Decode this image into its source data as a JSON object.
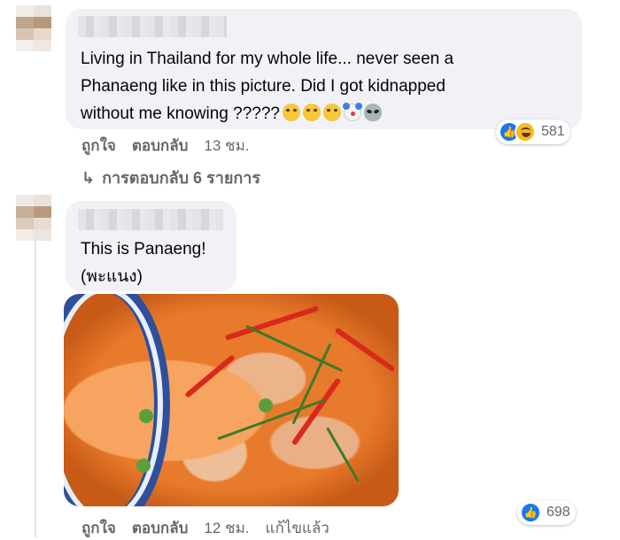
{
  "comments": [
    {
      "text": "Living in Thailand for my whole life... never seen a\nPhanaeng like in this picture. Did I got kidnapped\nwithout me knowing ?????",
      "emojis": [
        "crying-face",
        "crying-face",
        "crying-face",
        "clown-face",
        "alien-face"
      ],
      "reactions": {
        "icons": [
          "like-reaction-icon",
          "haha-reaction-icon"
        ],
        "count": "581"
      },
      "actions": {
        "like": "ถูกใจ",
        "reply": "ตอบกลับ",
        "time": "13 ชม."
      },
      "replies_link": "การตอบกลับ 6 รายการ"
    },
    {
      "text": "This is Panaeng!\n(พะแนง)",
      "reactions": {
        "icons": [
          "like-reaction-icon"
        ],
        "count": "698"
      },
      "actions": {
        "like": "ถูกใจ",
        "reply": "ตอบกลับ",
        "time": "12 ชม.",
        "edited": "แก้ไขแล้ว"
      },
      "image": "panang-curry-photo"
    }
  ],
  "colors": {
    "accent": "#1877f2",
    "bubble": "#f0f2f5",
    "meta": "#65676b"
  }
}
